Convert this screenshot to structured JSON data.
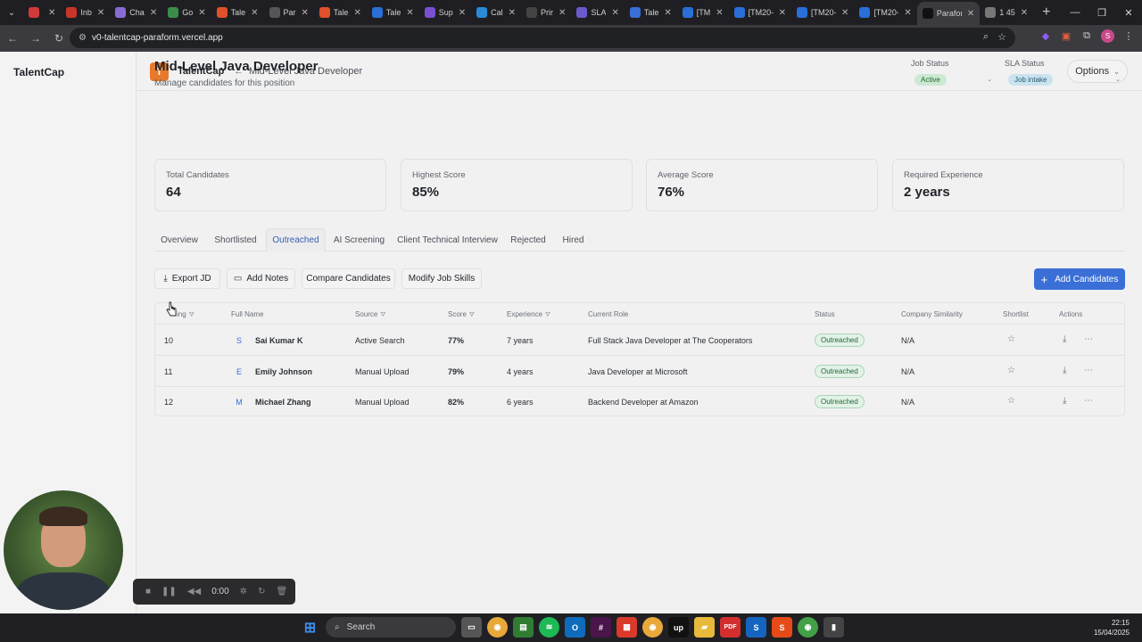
{
  "browser": {
    "tabs": [
      {
        "label": "",
        "color": "#d23a3a"
      },
      {
        "label": "Inb",
        "color": "#c8352a"
      },
      {
        "label": "Cha",
        "color": "#8a6bd6"
      },
      {
        "label": "Go",
        "color": "#3a8e4a"
      },
      {
        "label": "Tale",
        "color": "#e0502a"
      },
      {
        "label": "Par",
        "color": "#555555"
      },
      {
        "label": "Tale",
        "color": "#e0502a"
      },
      {
        "label": "Tale",
        "color": "#2a6ed8"
      },
      {
        "label": "Sup",
        "color": "#7b4fd0"
      },
      {
        "label": "Cal",
        "color": "#2a8ad8"
      },
      {
        "label": "Prir",
        "color": "#444444"
      },
      {
        "label": "SLA",
        "color": "#6a5acd"
      },
      {
        "label": "Tale",
        "color": "#3a6ed8"
      },
      {
        "label": "[TM",
        "color": "#2a6ed8"
      },
      {
        "label": "[TM20-",
        "color": "#2a6ed8"
      },
      {
        "label": "[TM20-",
        "color": "#2a6ed8"
      },
      {
        "label": "[TM20-",
        "color": "#2a6ed8"
      },
      {
        "label": "Parafor",
        "color": "#111111"
      },
      {
        "label": "1 45",
        "color": "#777777"
      }
    ],
    "url": "v0-talentcap-paraform.vercel.app"
  },
  "sidebar": {
    "brand": "TalentCap"
  },
  "topbar": {
    "logo_letter": "T",
    "app_name": "TalentCap",
    "breadcrumb": "Mid-Level Java Developer",
    "options_label": "Options"
  },
  "page": {
    "title": "Mid-Level Java Developer",
    "subtitle": "Manage candidates for this position",
    "job_status": {
      "label": "Job Status",
      "value": "Active"
    },
    "sla_status": {
      "label": "SLA Status",
      "value": "Job intake"
    }
  },
  "stats": [
    {
      "label": "Total Candidates",
      "value": "64"
    },
    {
      "label": "Highest Score",
      "value": "85%"
    },
    {
      "label": "Average Score",
      "value": "76%"
    },
    {
      "label": "Required Experience",
      "value": "2 years"
    }
  ],
  "tabs": [
    "Overview",
    "Shortlisted",
    "Outreached",
    "AI Screening",
    "Client Technical Interview",
    "Rejected",
    "Hired"
  ],
  "active_tab": "Outreached",
  "actions": {
    "export": "Export JD",
    "notes": "Add Notes",
    "compare": "Compare Candidates",
    "modify": "Modify Job Skills",
    "add": "Add Candidates"
  },
  "table": {
    "headers": [
      "ing",
      "Full Name",
      "Source",
      "Score",
      "Experience",
      "Current Role",
      "Status",
      "Company Similarity",
      "Shortlist",
      "Actions"
    ],
    "rows": [
      {
        "rank": "10",
        "initial": "S",
        "name": "Sai Kumar K",
        "source": "Active Search",
        "score": "77%",
        "experience": "7 years",
        "role": "Full Stack Java Developer at The Cooperators",
        "status": "Outreached",
        "similarity": "N/A"
      },
      {
        "rank": "11",
        "initial": "E",
        "name": "Emily Johnson",
        "source": "Manual Upload",
        "score": "79%",
        "experience": "4 years",
        "role": "Java Developer at Microsoft",
        "status": "Outreached",
        "similarity": "N/A"
      },
      {
        "rank": "12",
        "initial": "M",
        "name": "Michael Zhang",
        "source": "Manual Upload",
        "score": "82%",
        "experience": "6 years",
        "role": "Backend Developer at Amazon",
        "status": "Outreached",
        "similarity": "N/A"
      }
    ]
  },
  "recorder": {
    "time": "0:00"
  },
  "taskbar": {
    "search": "Search",
    "time": "22:15",
    "date": "15/04/2025"
  }
}
